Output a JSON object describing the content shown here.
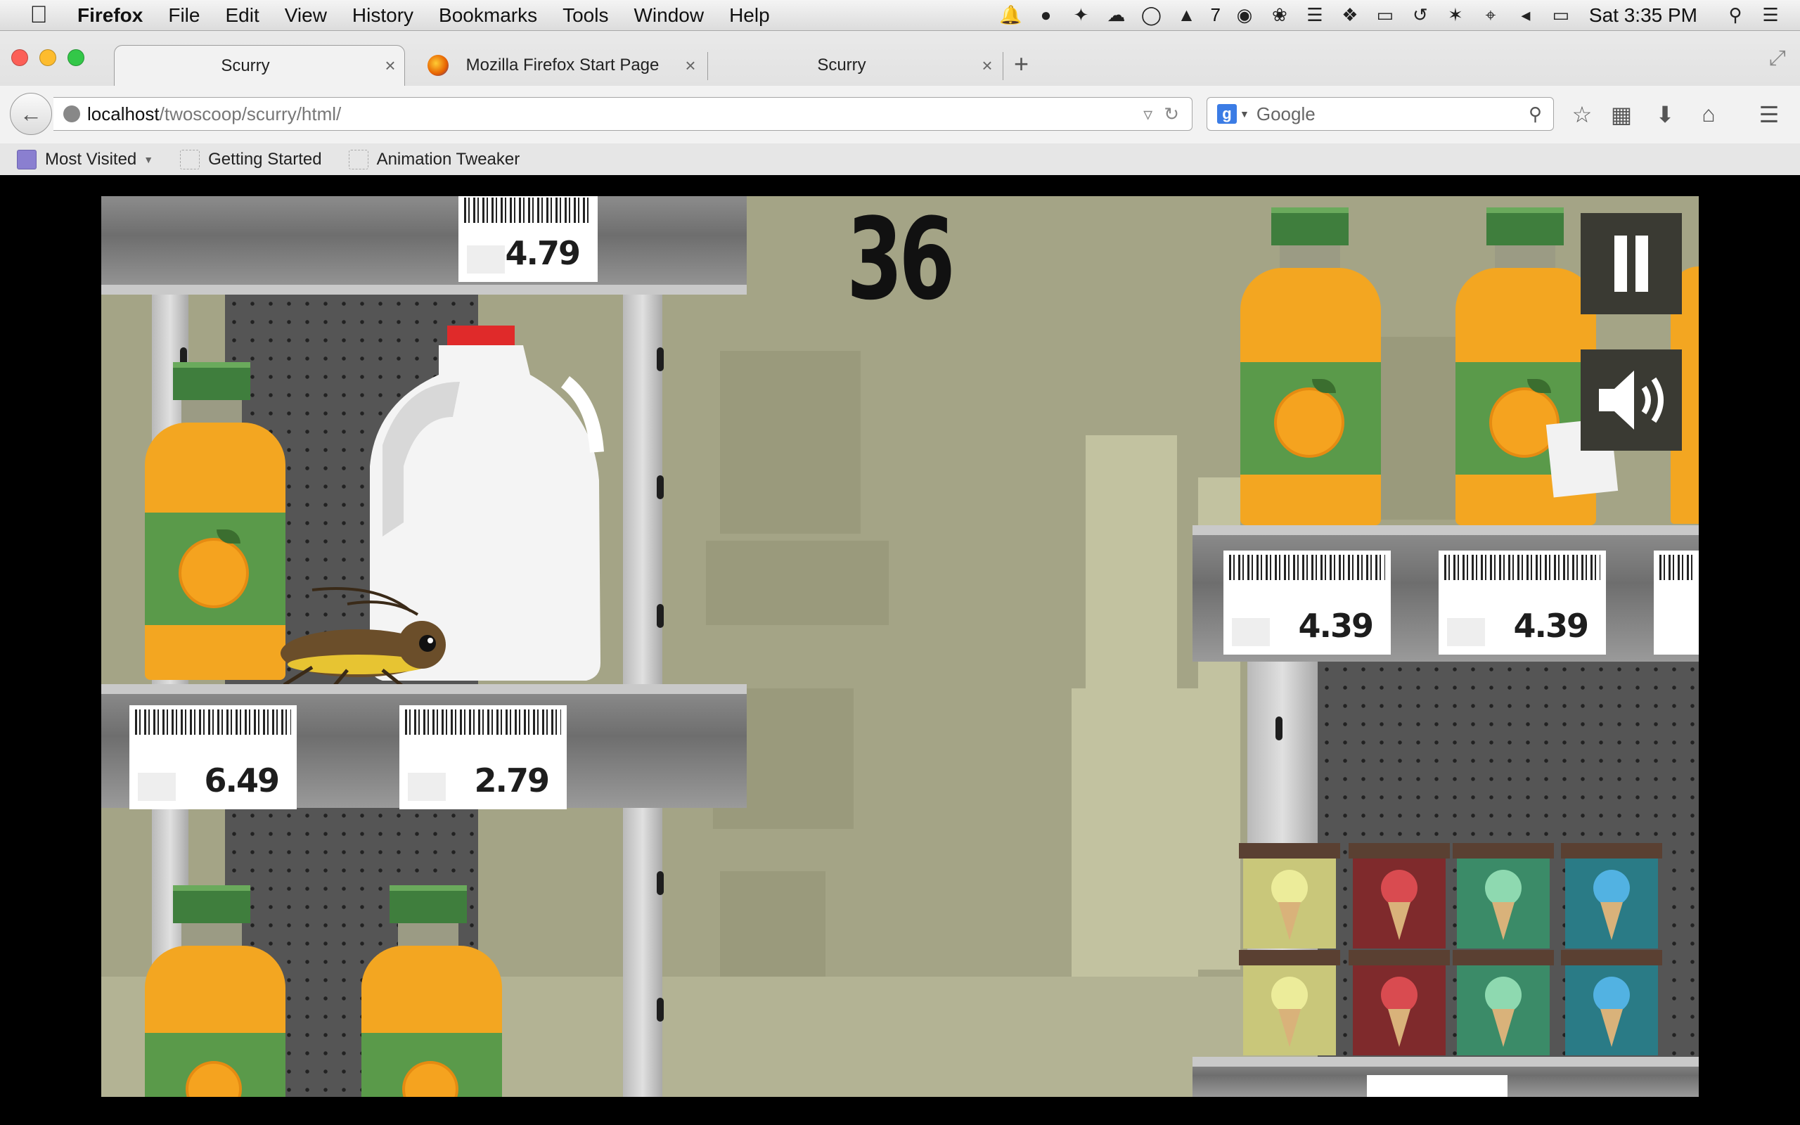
{
  "menubar": {
    "app": "Firefox",
    "items": [
      "File",
      "Edit",
      "View",
      "History",
      "Bookmarks",
      "Tools",
      "Window",
      "Help"
    ],
    "clock": "Sat 3:35 PM",
    "tray_badge": "7"
  },
  "tabs": [
    {
      "label": "Scurry",
      "active": true
    },
    {
      "label": "Mozilla Firefox Start Page",
      "active": false
    },
    {
      "label": "Scurry",
      "active": false
    }
  ],
  "urlbar": {
    "host": "localhost",
    "path": "/twoscoop/scurry/html/"
  },
  "search": {
    "engine_letter": "g",
    "placeholder": "Google"
  },
  "bookmarks": [
    "Most Visited",
    "Getting Started",
    "Animation Tweaker"
  ],
  "game": {
    "score": "36",
    "prices": {
      "top_left": "4.79",
      "left_1": "6.49",
      "left_2": "2.79",
      "right_1": "4.39",
      "right_2": "4.39"
    },
    "buttons": {
      "pause": "pause-icon",
      "sound": "speaker-icon"
    }
  },
  "colors": {
    "background": "#a4a486",
    "shelf": "#8c8c8c",
    "orange_juice": "#f3a621",
    "label_green": "#5a9a4a"
  }
}
